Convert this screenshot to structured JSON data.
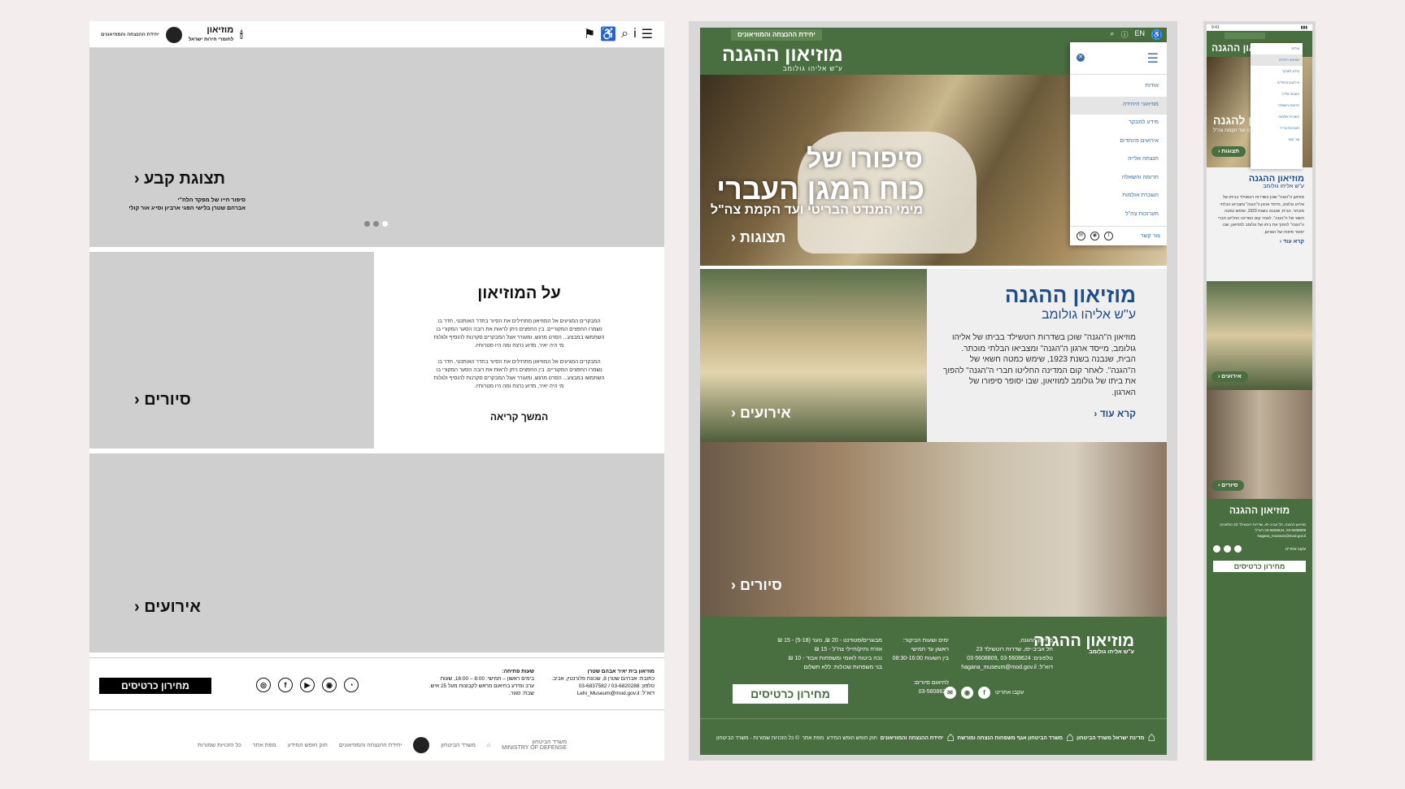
{
  "wireframe": {
    "topbar": {
      "brand_small": "יחידת ההנצחה והמוזיאונים",
      "logo_main": "מוזיאון",
      "logo_sub": "לחומרי חירות ישראל"
    },
    "hero": {
      "title": "תצוגת קבע",
      "subtitle_line1": "סיפור חייו של מפקד הלח\"י",
      "subtitle_line2": "אברהם שטרן בלישי הפגי ארביון וסייג אור קולי"
    },
    "tours_label": "סיורים",
    "about": {
      "title": "על המוזיאון",
      "para1": "המבקרים המגיעים אל המוזיאון מתחילים את הסיור בחדר האותנטי, חדר בו נשמרו החפצים המקוריים. בין החפצים ניתן לראות את רובה הסער המקורי בו השתמשו במבצע... הסרט מרגש, ומעורר אצל המבקרים סקרנות להוסיף ולגלות מי היה יאיר, מדוע נרצח ומה היו מטרותיו.",
      "para2": "המבקרים המגיעים אל המוזיאון מתחילים את הסיור בחדר האותנטי, חדר בו נשמרו החפצים המקוריים. בין החפצים ניתן לראות את רובה הסער המקורי בו השתמשו במבצע... הסרט מרגש, ומעורר אצל המבקרים סקרנות להוסיף ולגלות מי היה יאיר, מדוע נרצח ומה היו מטרותיו.",
      "more": "המשך קריאה"
    },
    "events_label": "אירועים",
    "footer": {
      "tickets": "מחירון כרטיסים",
      "address_title": "מוזיאון בית יאיר אבהם שטרן",
      "address_l1": "כתובת: אברהם שטרן 8, שכונת פלורנטין, אביב.",
      "address_l2": "טלפון: 03-6820288 / 03-6837582",
      "address_l3": "דוא\"ל: Lehi_Museum@mod.gov.il",
      "hours_title": "שעות פתיחה:",
      "hours_l1": "בימים ראשון – חמישי: 8:00 – 16:00, שעות",
      "hours_l2": "ערב ומידע בחיאום מראש לקבוצות מעל 25 איש.",
      "hours_l3": "שבת: סגור."
    },
    "bottom": {
      "rights": "כל הזכויות שמורות",
      "sitemap": "מפת אתר",
      "accessibility": "חוק חופש המידע",
      "unit": "יחידת ההנצחה והמוזיאונים",
      "ministry1": "משרד הביטחון",
      "ministry2": "MINISTRY OF DEFENSE"
    }
  },
  "desktop": {
    "topbar_badge": "יחידת ההנצחה והמוזיאונים",
    "lang": "EN",
    "logo_main": "מוזיאון ההגנה",
    "logo_sub": "ע\"ש אליהו גולומב",
    "hero": {
      "line1": "סיפורו של",
      "line2": "כוח המגן העברי",
      "line3": "מימי המנדט הבריטי ועד הקמת צה\"ל",
      "cta": "תצוגות"
    },
    "menu": {
      "items": [
        "אודות",
        "מוזיאוני היחידה",
        "מידע למבקר",
        "אירועים מיוחדים",
        "הנצחה אלייה",
        "תרומה והשאלה",
        "השכרת אולמות",
        "תערוכות צה\"ל"
      ],
      "contact": "צור קשר"
    },
    "events_cta": "אירועים",
    "about": {
      "title": "מוזיאון ההגנה",
      "subtitle": "ע\"ש אליהו גולומב",
      "text": "מוזיאון ה\"הגנה\" שוכן בשדרות רוטשילד בביתו של אליהו גולומב, מייסד ארגון ה\"הגנה\" ומצביאו הבלתי מוכתר. הבית, שנבנה בשנת 1923, שימש כמטה חשאי של ה\"הגנה\". לאחר קום המדינה החליטו חברי ה\"הגנה\" להפוך את ביתו של גולומב למוזיאון, שבו יסופר סיפורו של הארגון.",
      "more": "קרא עוד"
    },
    "tours_cta": "סיורים",
    "footer": {
      "logo_main": "מוזיאון ההגנה",
      "logo_sub": "ע\"ש אליהו גולומב",
      "addr": [
        "מוזיאון ההגנה,",
        "תל אביב-יפו, שדרות רוטשילד 23",
        "טלפונים: 03-5608624 ,03-5608809",
        "דוא\"ל: hagana_museum@mod.gov.il"
      ],
      "hours": [
        "ימים ושעות הביקור:",
        "ראשון עד חמישי",
        "בין השעות 08:30-16:00"
      ],
      "groups": [
        "מבוגרים/סטודנט - 20 ₪, נוער (5-18) - 15 ₪",
        "אזרח ותיק/חיילי צה\"ל - 15 ₪",
        "נכה ביטוח לאומי ומשפחות אבוד - 10 ₪",
        "בני משפחות שכולות: ללא תשלום"
      ],
      "booking": [
        "לתיאום סיורים:",
        "03-5608624"
      ],
      "follow": "עקבו אחרינו",
      "tickets": "מחירון כרטיסים",
      "bottom": [
        "מדינת ישראל משרד הביטחון",
        "משרד הביטחון אגף משפחות הנצחה ומורשת",
        "יחידת ההנצחה והמוזיאונים",
        "חוק חופש חופש המידע",
        "מפת אתר",
        "© כל הזכויות שמורות - משרד הביטחון"
      ]
    }
  },
  "mobile": {
    "time": "9:41",
    "logo": "מוזיאון ההגנה",
    "hero_title": "מוזיאון להגנה",
    "hero_sub": "מימי המנדט ועד הקמת צה\"ל",
    "hero_cta": "תצוגות",
    "menu": [
      "אודות",
      "מוזיאוני היחידה",
      "מידע למבקר",
      "אירועים מיוחדים",
      "הנצחה אלייה",
      "תרומה והשאלה",
      "השכרת אולמות",
      "תערוכות צה\"ל",
      "צור קשר"
    ],
    "about_title": "מוזיאון ההגנה",
    "about_sub": "ע\"ש אליהו גולומב",
    "about_text": "מוזיאון ה\"הגנה\" שוכן בשדרות רוטשילד בביתו של אליהו גולומב, מייסד ארגון ה\"הגנה\" ומצביאו הבלתי מוכתר. הבית, שנבנה בשנת 1923, שימש כמטה חשאי של ה\"הגנה\". לאחר קום המדינה החליטו חברי ה\"הגנה\" להפוך את ביתו של גולומב למוזיאון, שבו יסופר סיפורו של הארגון.",
    "about_more": "קרא עוד",
    "events": "אירועים",
    "tours": "סיורים",
    "footer_logo": "מוזיאון ההגנה",
    "footer_text": "מוזיאון ההגנה, תל אביב-יפו, שדרות רוטשילד 23 טלפונים: 03-5608809 ,03-5608624 דוא\"ל: hagana_museum@mod.gov.il",
    "follow": "עקבו אחרינו",
    "tickets": "מחירון כרטיסים"
  }
}
